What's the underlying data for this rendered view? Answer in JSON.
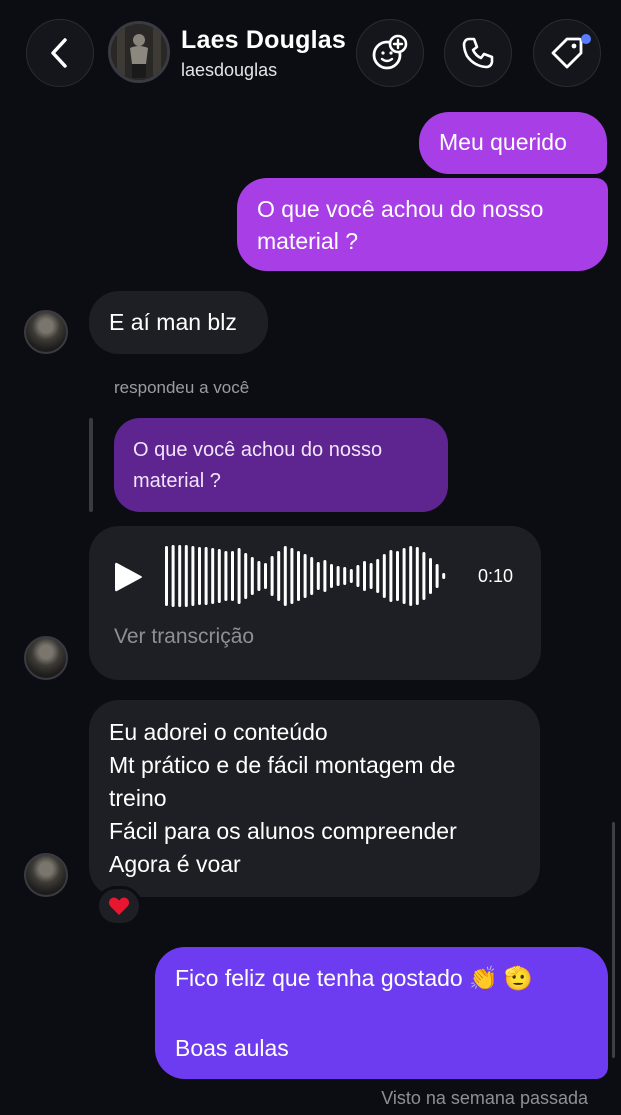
{
  "header": {
    "contact_name": "Laes Douglas",
    "username": "laesdouglas",
    "icons": [
      "chevron-left-icon",
      "add-friend-icon",
      "phone-icon",
      "tag-icon"
    ]
  },
  "messages": {
    "out1": "Meu querido",
    "out2_line1": "O que você achou do nosso",
    "out2_line2": "material ?",
    "in1": "E aí man blz",
    "reply_label": "respondeu a você",
    "quote_line1": "O que você achou do nosso",
    "quote_line2": "material ?",
    "voice": {
      "duration": "0:10",
      "transcript_label": "Ver transcrição"
    },
    "in3_lines": [
      "Eu adorei o conteúdo",
      "Mt prático e de fácil montagem de",
      "treino",
      "Fácil para os alunos compreender",
      "Agora é voar"
    ],
    "reaction": "❤️",
    "out3_line1": "Fico feliz que tenha gostado 👏 🫡",
    "out3_line2": "Boas aulas"
  },
  "status": {
    "seen": "Visto na semana passada"
  },
  "colors": {
    "background": "#0c0d12",
    "outgoing_bubble": "#a73ee6",
    "outgoing_last": "#6e3cf0",
    "incoming_bubble": "#1e1f25",
    "quoted_bubble": "#5e2590"
  }
}
